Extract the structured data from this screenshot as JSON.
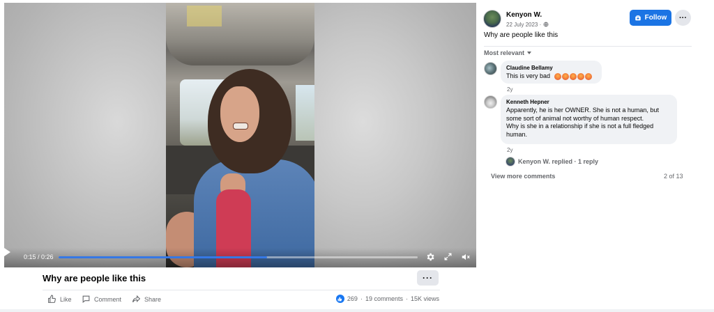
{
  "video": {
    "time": "0:15 / 0:26",
    "progress_fraction": 0.58,
    "title": "Why are people like this",
    "more_label": "···"
  },
  "actions": {
    "like": "Like",
    "comment": "Comment",
    "share": "Share"
  },
  "stats": {
    "reactions": "269",
    "comments": "19 comments",
    "views": "15K views",
    "separator": "·"
  },
  "post": {
    "author": "Kenyon W.",
    "date": "22 July 2023 ·",
    "text": "Why are people like this",
    "follow_label": "Follow",
    "more_label": "···"
  },
  "comments_section": {
    "sort_label": "Most relevant",
    "comments": [
      {
        "name": "Claudine Bellamy",
        "text": "This is very bad",
        "age": "2y",
        "emoji_count": 5
      },
      {
        "name": "Kenneth Hepner",
        "text_lines": [
          "Apparently, he is her OWNER. She is not a human, but",
          "some sort of animal not worthy of human respect.",
          "Why is she in a relationship if she is not a full fledged",
          "human."
        ],
        "age": "2y"
      }
    ],
    "reply_summary": "Kenyon W. replied · 1 reply",
    "view_more": "View more comments",
    "count": "2 of 13"
  },
  "colors": {
    "accent": "#1b74e4",
    "progress": "#3578e5",
    "secondary_text": "#65676b"
  }
}
